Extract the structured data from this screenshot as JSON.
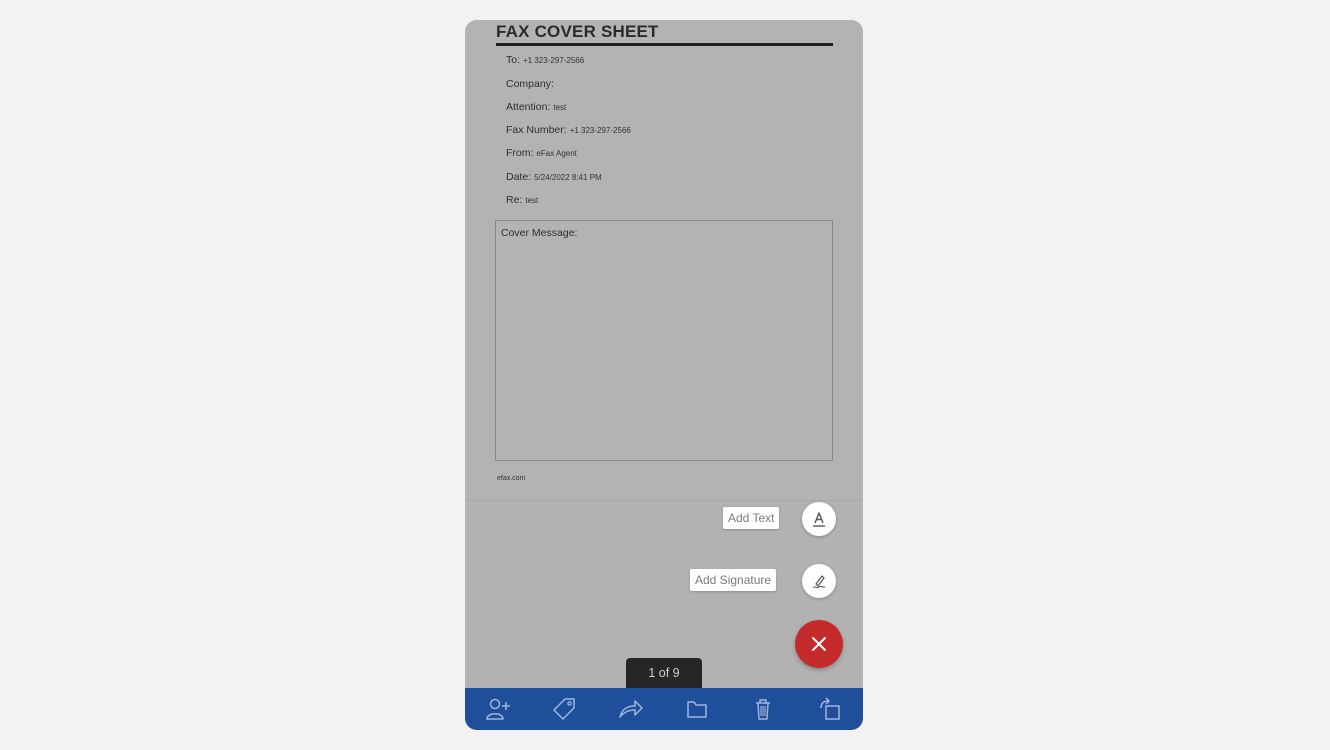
{
  "document": {
    "title": "FAX COVER SHEET",
    "fields": [
      {
        "label": "To:",
        "value": "+1 323-297-2566"
      },
      {
        "label": "Company:",
        "value": ""
      },
      {
        "label": "Attention:",
        "value": "test"
      },
      {
        "label": "Fax Number:",
        "value": "+1 323-297-2566"
      },
      {
        "label": "From:",
        "value": "eFax Agent"
      },
      {
        "label": "Date:",
        "value": "5/24/2022 8:41 PM"
      },
      {
        "label": "Re:",
        "value": "test"
      }
    ],
    "cover_message_label": "Cover Message:",
    "footer": "efax.com"
  },
  "actions": {
    "add_text_label": "Add Text",
    "add_signature_label": "Add Signature"
  },
  "pager": {
    "text": "1 of 9"
  },
  "toolbar": {
    "items": [
      "add-contact-icon",
      "tag-icon",
      "forward-icon",
      "folder-icon",
      "trash-icon",
      "rotate-icon"
    ]
  },
  "colors": {
    "toolbar": "#1f4f9a",
    "close_fab": "#c52a2a",
    "overlay": "#b2b2b2"
  }
}
